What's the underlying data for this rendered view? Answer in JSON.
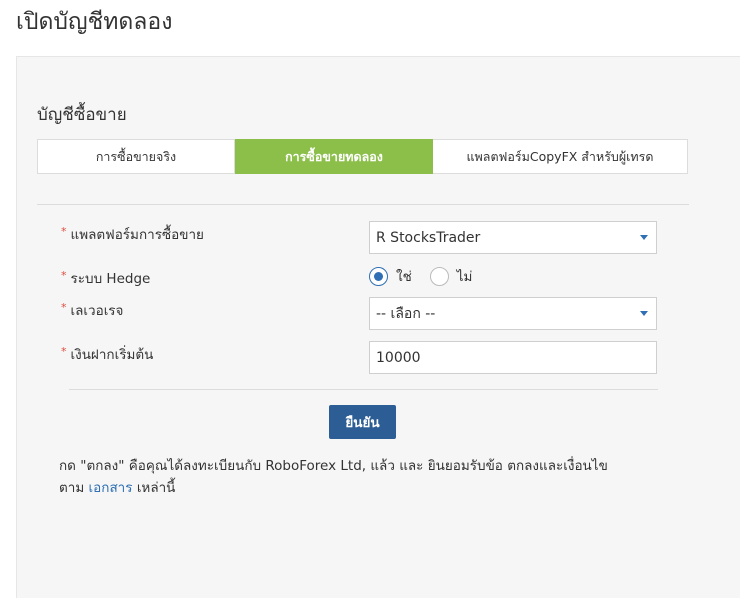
{
  "page": {
    "title": "เปิดบัญชีทดลอง"
  },
  "section": {
    "title": "บัญชีซื้อขาย"
  },
  "tabs": [
    {
      "label": "การซื้อขายจริง",
      "active": false
    },
    {
      "label": "การซื้อขายทดลอง",
      "active": true
    },
    {
      "label": "แพลตฟอร์มCopyFX สำหรับผู้เทรด",
      "active": false
    }
  ],
  "form": {
    "required_mark": "*",
    "platform": {
      "label": "แพลตฟอร์มการซื้อขาย",
      "value": "R StocksTrader"
    },
    "hedge": {
      "label": "ระบบ Hedge",
      "options": [
        "ใช่",
        "ไม่"
      ],
      "selected": "ใช่"
    },
    "leverage": {
      "label": "เลเวอเรจ",
      "value": "-- เลือก --"
    },
    "deposit": {
      "label": "เงินฝากเริ่มต้น",
      "value": "10000"
    },
    "confirm_label": "ยืนยัน"
  },
  "terms": {
    "line1": "กด \"ตกลง\" คือคุณได้ลงทะเบียนกับ RoboForex Ltd, แล้ว และ ยินยอมรับข้อ ตกลงและเงื่อนไข",
    "line2_prefix": "ตาม",
    "link_text": "เอกสาร",
    "line2_suffix": "เหล่านี้"
  },
  "colors": {
    "accent_green": "#8cbf4a",
    "button_blue": "#2c5d94",
    "link_blue": "#2f6fb3",
    "required_red": "#e04a3f"
  }
}
